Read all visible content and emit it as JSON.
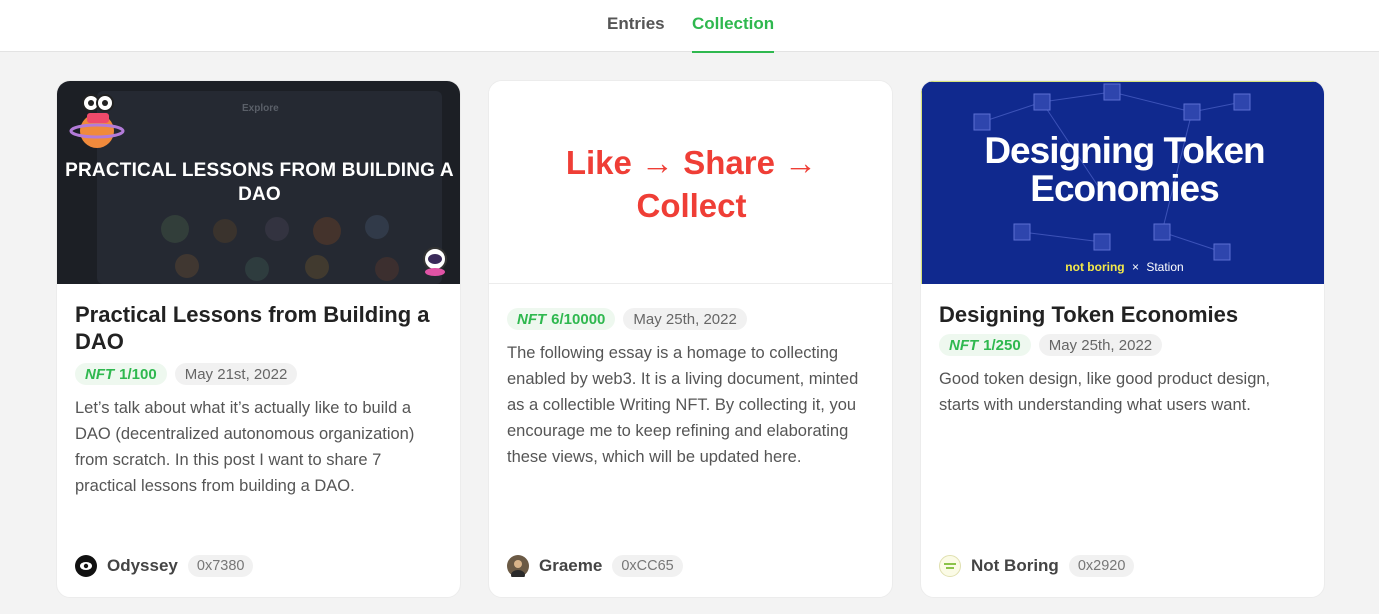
{
  "tabs": {
    "entries": "Entries",
    "collection": "Collection"
  },
  "cards": [
    {
      "cover_text": "PRACTICAL LESSONS FROM BUILDING A DAO",
      "cover_faint": "Explore",
      "title": "Practical Lessons from Building a DAO",
      "nft_label": "NFT",
      "edition": "1/100",
      "date": "May 21st, 2022",
      "description": "Let’s talk about what it’s actually like to build a DAO (decentralized autonomous organization) from scratch. In this post I want to share 7 practical lessons from building a DAO.",
      "author": "Odyssey",
      "address": "0x7380"
    },
    {
      "cover_text": "Like → Share → Collect",
      "nft_label": "NFT",
      "edition": "6/10000",
      "date": "May 25th, 2022",
      "description": "The following essay is a homage to collecting enabled by web3. It is a living document, minted as a collectible Writing NFT. By collecting it, you encourage me to keep refining and elaborating these views, which will be updated here.",
      "author": "Graeme",
      "address": "0xCC65"
    },
    {
      "cover_text": "Designing Token Economies",
      "cover_brand": "not boring",
      "cover_x": "×",
      "cover_partner": "Station",
      "title": "Designing Token Economies",
      "nft_label": "NFT",
      "edition": "1/250",
      "date": "May 25th, 2022",
      "description": "Good token design, like good product design, starts with understanding what users want.",
      "author": "Not Boring",
      "address": "0x2920"
    }
  ],
  "colors": {
    "accent": "#2fb84f",
    "red": "#ef3e36",
    "navy": "#10298e"
  }
}
